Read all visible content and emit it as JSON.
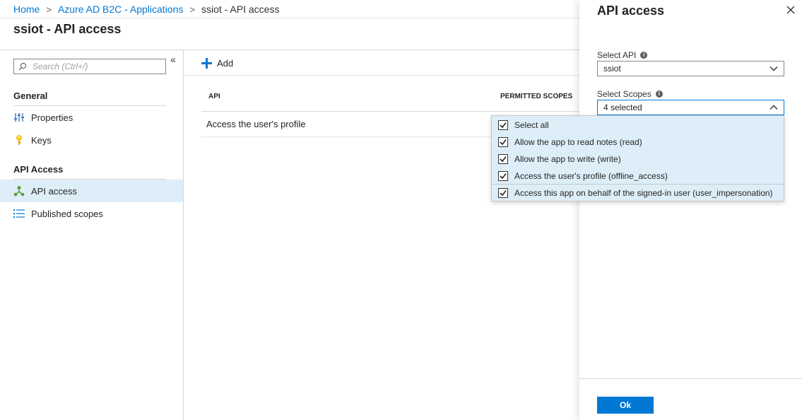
{
  "breadcrumb": {
    "items": [
      "Home",
      "Azure AD B2C - Applications",
      "ssiot - API access"
    ],
    "separator": ">"
  },
  "page": {
    "title": "ssiot - API access"
  },
  "left_nav": {
    "collapse_glyph": "«",
    "search_placeholder": "Search (Ctrl+/)",
    "sections": [
      {
        "title": "General",
        "items": [
          {
            "label": "Properties",
            "icon": "properties-icon"
          },
          {
            "label": "Keys",
            "icon": "key-icon"
          }
        ]
      },
      {
        "title": "API Access",
        "items": [
          {
            "label": "API access",
            "icon": "api-access-icon",
            "active": true
          },
          {
            "label": "Published scopes",
            "icon": "list-icon"
          }
        ]
      }
    ]
  },
  "toolbar": {
    "add_label": "Add"
  },
  "table": {
    "columns": [
      "API",
      "PERMITTED SCOPES"
    ],
    "rows": [
      {
        "api": "Access the user's profile"
      }
    ]
  },
  "panel": {
    "title": "API access",
    "select_api": {
      "label": "Select API",
      "value": "ssiot"
    },
    "select_scopes": {
      "label": "Select Scopes",
      "value": "4 selected",
      "options": [
        {
          "label": "Select all",
          "checked": true
        },
        {
          "label": "Allow the app to read notes (read)",
          "checked": true
        },
        {
          "label": "Allow the app to write (write)",
          "checked": true
        },
        {
          "label": "Access the user's profile (offline_access)",
          "checked": true
        },
        {
          "label": "Access this app on behalf of the signed-in user (user_impersonation)",
          "checked": true
        }
      ]
    },
    "ok_label": "Ok"
  },
  "colors": {
    "accent": "#0078d4",
    "nav_active_bg": "#ddeef9",
    "dropdown_bg": "#ddeef9",
    "text": "#252423"
  }
}
